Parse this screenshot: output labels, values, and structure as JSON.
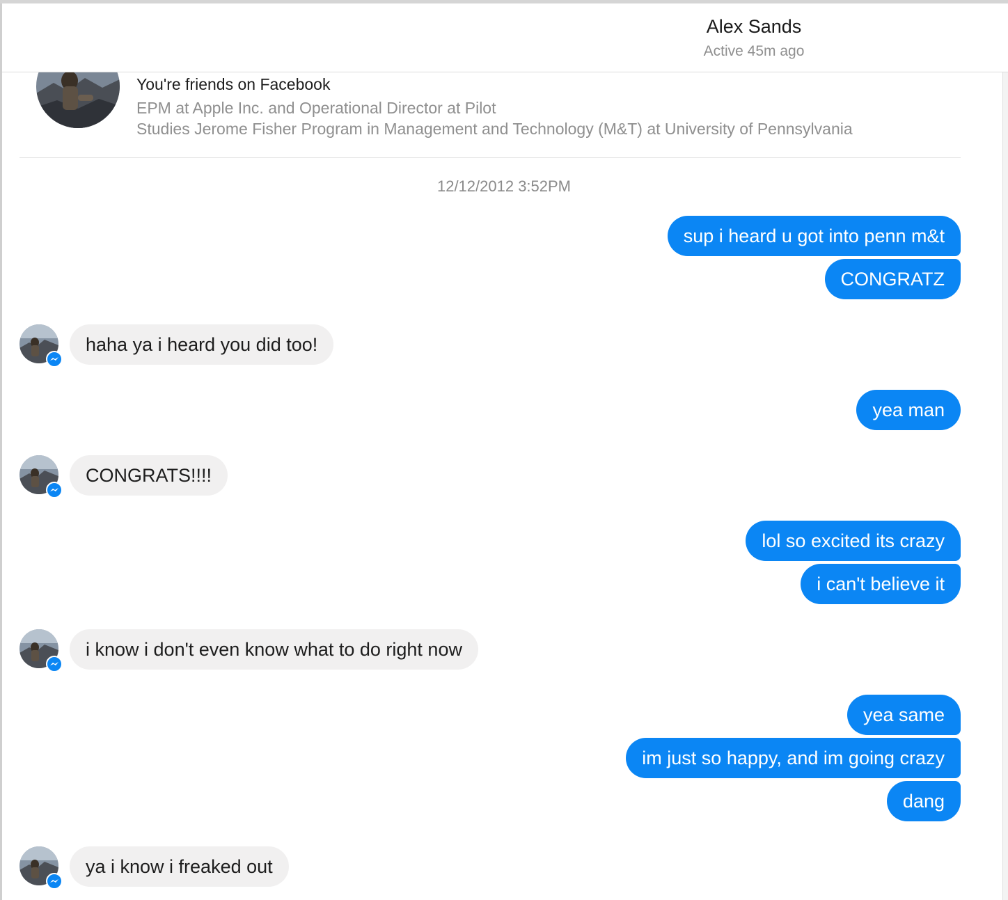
{
  "header": {
    "contact_name": "Alex Sands",
    "status": "Active 45m ago"
  },
  "profile": {
    "friends_title": "You're friends on Facebook",
    "work": "EPM at Apple Inc. and Operational Director at Pilot",
    "education": "Studies Jerome Fisher Program in Management and Technology (M&T) at University of Pennsylvania"
  },
  "conversation": {
    "timestamp": "12/12/2012 3:52PM",
    "messages": [
      {
        "from": "me",
        "text": "sup i heard u got into penn m&t"
      },
      {
        "from": "me",
        "text": "CONGRATZ"
      },
      {
        "from": "contact",
        "text": "haha ya i heard you did too!"
      },
      {
        "from": "me",
        "text": "yea man"
      },
      {
        "from": "contact",
        "text": "CONGRATS!!!!"
      },
      {
        "from": "me",
        "text": "lol so excited its crazy"
      },
      {
        "from": "me",
        "text": "i can't believe it"
      },
      {
        "from": "contact",
        "text": "i know i don't even know what to do right now"
      },
      {
        "from": "me",
        "text": "yea same"
      },
      {
        "from": "me",
        "text": "im just so happy, and im going crazy"
      },
      {
        "from": "me",
        "text": "dang"
      },
      {
        "from": "contact",
        "text": "ya i know i freaked out"
      }
    ]
  },
  "colors": {
    "outgoing_bubble": "#0b86f4",
    "incoming_bubble": "#f1f0f0",
    "messenger_badge": "#0b86f4"
  },
  "icons": {
    "contact_avatar": "profile-photo",
    "messenger_badge": "messenger-icon"
  }
}
